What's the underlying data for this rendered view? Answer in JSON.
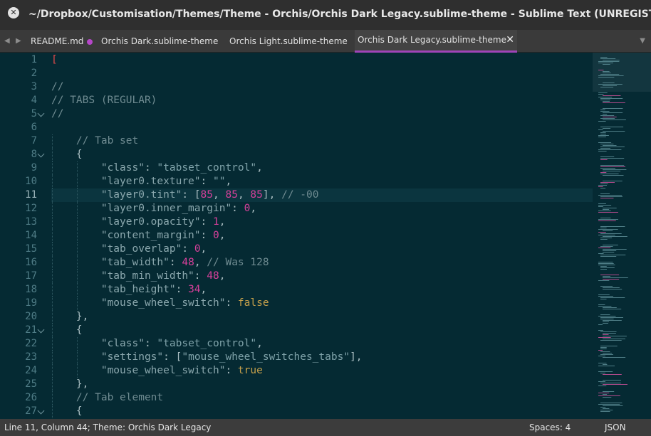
{
  "window": {
    "title": "~/Dropbox/Customisation/Themes/Theme - Orchis/Orchis Dark Legacy.sublime-theme - Sublime Text (UNREGISTERED)"
  },
  "tabs": [
    {
      "label": "README.md",
      "dirty": true
    },
    {
      "label": "Orchis Dark.sublime-theme",
      "dirty": false
    },
    {
      "label": "Orchis Light.sublime-theme",
      "dirty": false
    },
    {
      "label": "Orchis Dark Legacy.sublime-theme",
      "active": true
    }
  ],
  "icons": {
    "window_close": "close-circle-icon",
    "tab_close": "close-icon",
    "nav_left": "triangle-left-icon",
    "nav_right": "triangle-right-icon",
    "overflow": "triangle-down-icon",
    "fold": "chevron-down-icon"
  },
  "colors": {
    "accent": "#a044b8",
    "background": "#052a33",
    "number": "#d6409a",
    "boolean": "#c6a04b"
  },
  "editor": {
    "current_line": 11,
    "lines": [
      {
        "n": "1",
        "text": "[",
        "fold": false
      },
      {
        "n": "2",
        "text": "",
        "fold": false
      },
      {
        "n": "3",
        "text": "//",
        "fold": false
      },
      {
        "n": "4",
        "text": "// TABS (REGULAR)",
        "fold": false
      },
      {
        "n": "5",
        "text": "//",
        "fold": true
      },
      {
        "n": "6",
        "text": "",
        "fold": false
      },
      {
        "n": "7",
        "text": "    // Tab set",
        "fold": false
      },
      {
        "n": "8",
        "text": "    {",
        "fold": true
      },
      {
        "n": "9",
        "text": "        \"class\": \"tabset_control\",",
        "fold": false
      },
      {
        "n": "10",
        "text": "        \"layer0.texture\": \"\",",
        "fold": false
      },
      {
        "n": "11",
        "text": "        \"layer0.tint\": [85, 85, 85], // -00",
        "fold": false
      },
      {
        "n": "12",
        "text": "        \"layer0.inner_margin\": 0,",
        "fold": false
      },
      {
        "n": "13",
        "text": "        \"layer0.opacity\": 1,",
        "fold": false
      },
      {
        "n": "14",
        "text": "        \"content_margin\": 0,",
        "fold": false
      },
      {
        "n": "15",
        "text": "        \"tab_overlap\": 0,",
        "fold": false
      },
      {
        "n": "16",
        "text": "        \"tab_width\": 48, // Was 128",
        "fold": false
      },
      {
        "n": "17",
        "text": "        \"tab_min_width\": 48,",
        "fold": false
      },
      {
        "n": "18",
        "text": "        \"tab_height\": 34,",
        "fold": false
      },
      {
        "n": "19",
        "text": "        \"mouse_wheel_switch\": false",
        "fold": false
      },
      {
        "n": "20",
        "text": "    },",
        "fold": false
      },
      {
        "n": "21",
        "text": "    {",
        "fold": true
      },
      {
        "n": "22",
        "text": "        \"class\": \"tabset_control\",",
        "fold": false
      },
      {
        "n": "23",
        "text": "        \"settings\": [\"mouse_wheel_switches_tabs\"],",
        "fold": false
      },
      {
        "n": "24",
        "text": "        \"mouse_wheel_switch\": true",
        "fold": false
      },
      {
        "n": "25",
        "text": "    },",
        "fold": false
      },
      {
        "n": "26",
        "text": "    // Tab element",
        "fold": false
      },
      {
        "n": "27",
        "text": "    {",
        "fold": true
      }
    ]
  },
  "status": {
    "left": "Line 11, Column 44; Theme: Orchis Dark Legacy",
    "spaces": "Spaces: 4",
    "syntax": "JSON"
  }
}
